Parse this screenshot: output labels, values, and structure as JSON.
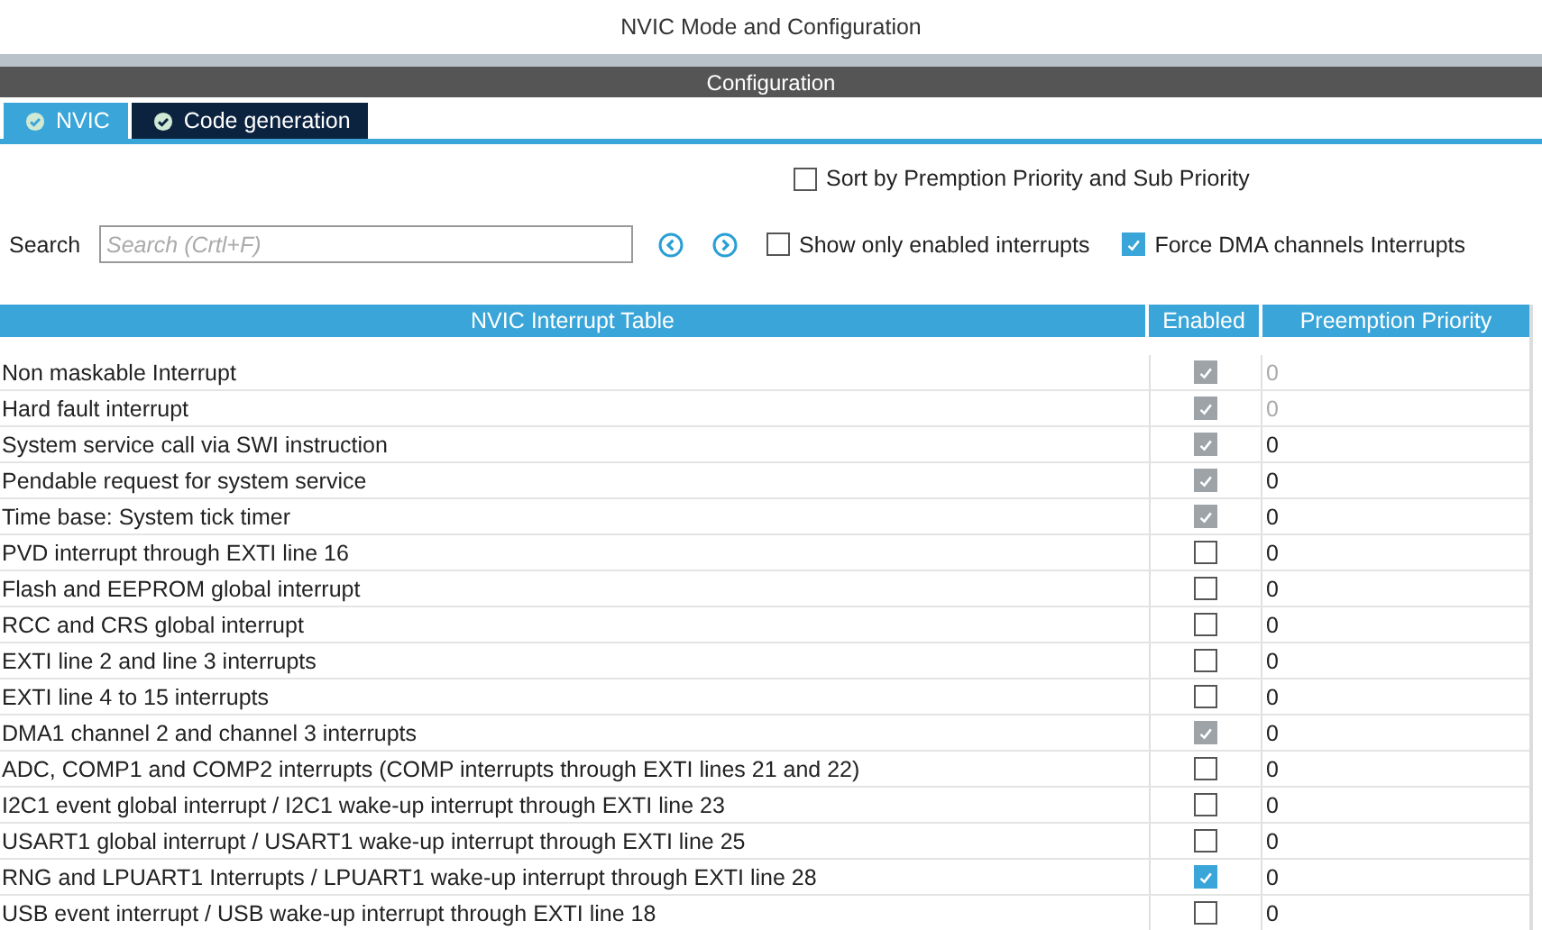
{
  "window": {
    "title": "NVIC Mode and Configuration"
  },
  "section_title": "Configuration",
  "tabs": [
    {
      "label": "NVIC",
      "selected": true
    },
    {
      "label": "Code generation",
      "selected": false
    }
  ],
  "options": [
    {
      "label": "Sort by Premption Priority and Sub Priority",
      "checked": false
    },
    {
      "label": "Show only enabled interrupts",
      "checked": false
    },
    {
      "label": "Force DMA channels Interrupts",
      "checked": true
    }
  ],
  "search": {
    "label": "Search",
    "placeholder": "Search (Crtl+F)"
  },
  "table": {
    "columns": [
      "NVIC Interrupt Table",
      "Enabled",
      "Preemption Priority"
    ],
    "rows": [
      {
        "name": "Non maskable Interrupt",
        "enabled": true,
        "disabled": true,
        "priority": "0",
        "priority_disabled": true
      },
      {
        "name": "Hard fault interrupt",
        "enabled": true,
        "disabled": true,
        "priority": "0",
        "priority_disabled": true
      },
      {
        "name": "System service call via SWI instruction",
        "enabled": true,
        "disabled": true,
        "priority": "0",
        "priority_disabled": false
      },
      {
        "name": "Pendable request for system service",
        "enabled": true,
        "disabled": true,
        "priority": "0",
        "priority_disabled": false
      },
      {
        "name": "Time base: System tick timer",
        "enabled": true,
        "disabled": true,
        "priority": "0",
        "priority_disabled": false
      },
      {
        "name": "PVD interrupt through EXTI line 16",
        "enabled": false,
        "disabled": false,
        "priority": "0",
        "priority_disabled": false
      },
      {
        "name": "Flash and EEPROM global interrupt",
        "enabled": false,
        "disabled": false,
        "priority": "0",
        "priority_disabled": false
      },
      {
        "name": "RCC and CRS global interrupt",
        "enabled": false,
        "disabled": false,
        "priority": "0",
        "priority_disabled": false
      },
      {
        "name": "EXTI line 2 and line 3 interrupts",
        "enabled": false,
        "disabled": false,
        "priority": "0",
        "priority_disabled": false
      },
      {
        "name": "EXTI line 4 to 15 interrupts",
        "enabled": false,
        "disabled": false,
        "priority": "0",
        "priority_disabled": false
      },
      {
        "name": "DMA1 channel 2 and channel 3 interrupts",
        "enabled": true,
        "disabled": true,
        "priority": "0",
        "priority_disabled": false
      },
      {
        "name": "ADC, COMP1 and COMP2 interrupts (COMP interrupts through EXTI lines 21 and 22)",
        "enabled": false,
        "disabled": false,
        "priority": "0",
        "priority_disabled": false
      },
      {
        "name": "I2C1 event global interrupt / I2C1 wake-up interrupt through EXTI line 23",
        "enabled": false,
        "disabled": false,
        "priority": "0",
        "priority_disabled": false
      },
      {
        "name": "USART1 global interrupt / USART1 wake-up interrupt through EXTI line 25",
        "enabled": false,
        "disabled": false,
        "priority": "0",
        "priority_disabled": false
      },
      {
        "name": "RNG and LPUART1 Interrupts / LPUART1 wake-up interrupt through EXTI line 28",
        "enabled": true,
        "disabled": false,
        "priority": "0",
        "priority_disabled": false
      },
      {
        "name": "USB event interrupt / USB wake-up interrupt through EXTI line 18",
        "enabled": false,
        "disabled": false,
        "priority": "0",
        "priority_disabled": false
      }
    ]
  }
}
